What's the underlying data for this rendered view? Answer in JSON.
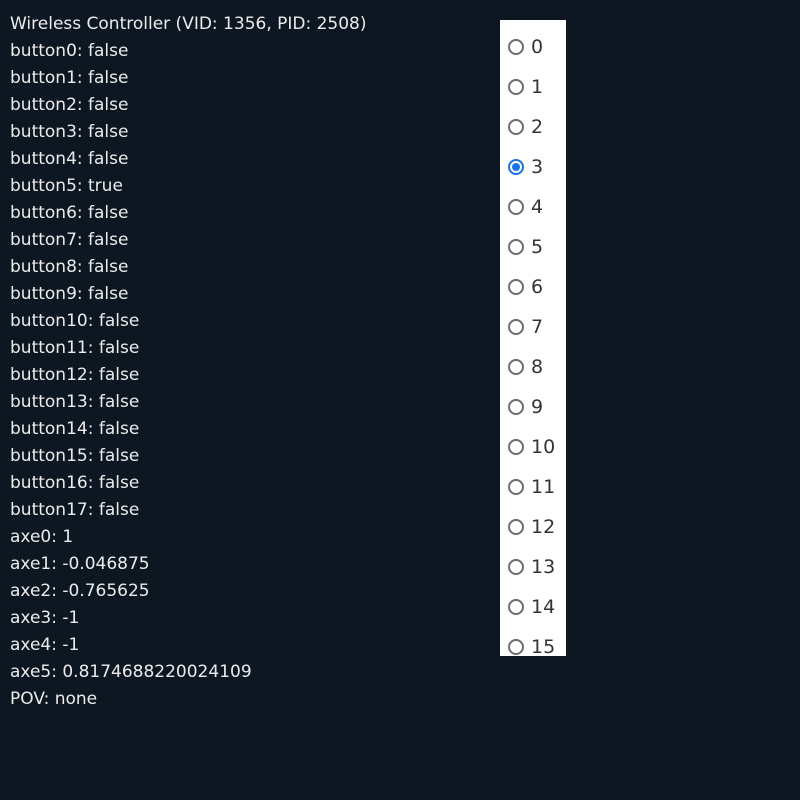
{
  "status": {
    "title": "Wireless Controller (VID: 1356, PID: 2508)",
    "lines": [
      "button0: false",
      "button1: false",
      "button2: false",
      "button3: false",
      "button4: false",
      "button5: true",
      "button6: false",
      "button7: false",
      "button8: false",
      "button9: false",
      "button10: false",
      "button11: false",
      "button12: false",
      "button13: false",
      "button14: false",
      "button15: false",
      "button16: false",
      "button17: false",
      "axe0: 1",
      "axe1: -0.046875",
      "axe2: -0.765625",
      "axe3: -1",
      "axe4: -1",
      "axe5: 0.8174688220024109",
      "POV: none"
    ]
  },
  "radio_list": {
    "options": [
      "0",
      "1",
      "2",
      "3",
      "4",
      "5",
      "6",
      "7",
      "8",
      "9",
      "10",
      "11",
      "12",
      "13",
      "14",
      "15"
    ],
    "selected": "3"
  }
}
